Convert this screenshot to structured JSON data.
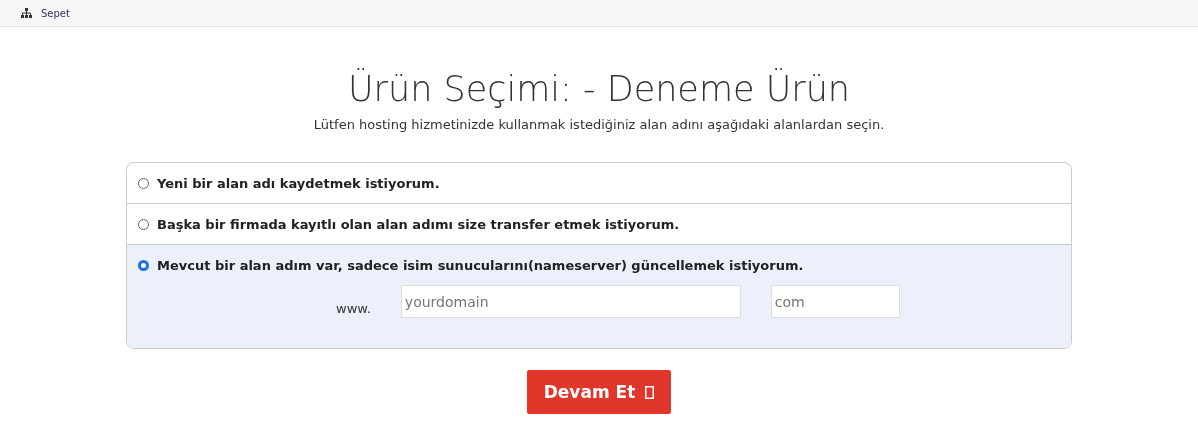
{
  "breadcrumb": {
    "label": "Sepet"
  },
  "title": "Ürün Seçimi: - Deneme Ürün",
  "subtitle": "Lütfen hosting hizmetinizde kullanmak istediğiniz alan adını aşağıdaki alanlardan seçin.",
  "options": [
    {
      "label": "Yeni bir alan adı kaydetmek istiyorum.",
      "selected": false
    },
    {
      "label": "Başka bir firmada kayıtlı olan alan adımı size transfer etmek istiyorum.",
      "selected": false
    },
    {
      "label": "Mevcut bir alan adım var, sadece isim sunucularını(nameserver) güncellemek istiyorum.",
      "selected": true
    }
  ],
  "domain": {
    "prefix": "www.",
    "name_placeholder": "yourdomain",
    "tld_placeholder": "com"
  },
  "continue_button": {
    "label": "Devam Et"
  }
}
